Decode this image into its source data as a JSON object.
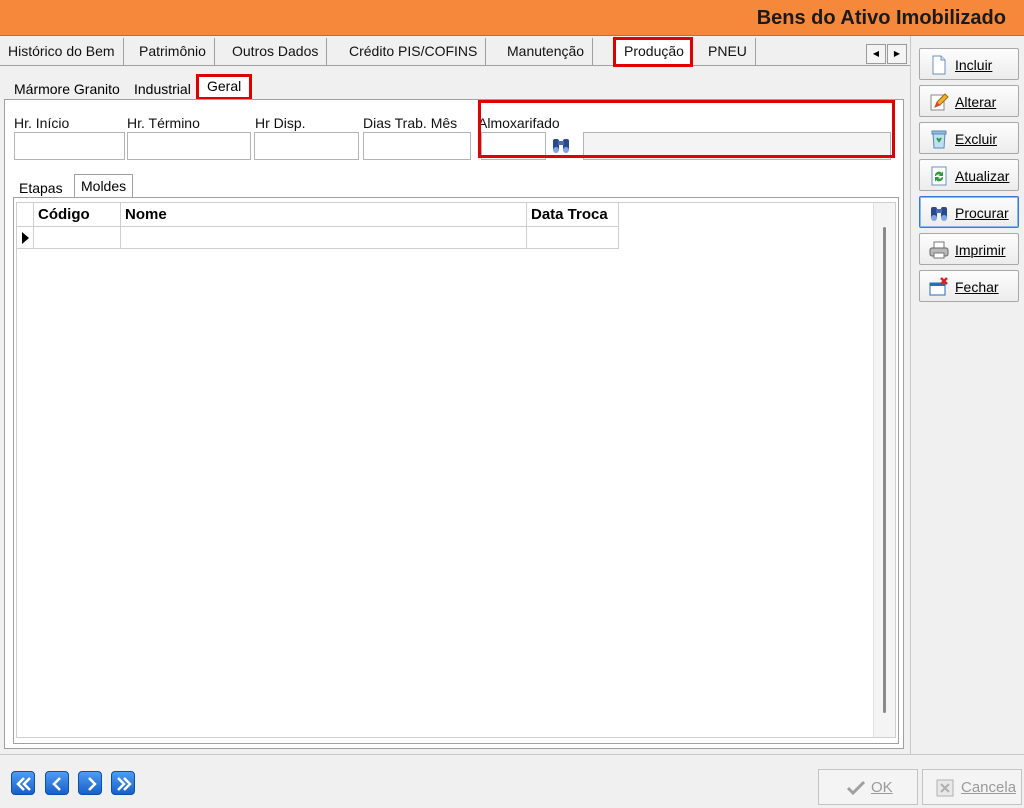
{
  "window": {
    "title": "Bens do Ativo Imobilizado"
  },
  "tabs_main": [
    {
      "label": "Histórico do Bem"
    },
    {
      "label": "Patrimônio"
    },
    {
      "label": "Outros Dados"
    },
    {
      "label": "Crédito PIS/COFINS"
    },
    {
      "label": "Manutenção"
    },
    {
      "label": "Produção",
      "active": true
    },
    {
      "label": "PNEU"
    }
  ],
  "tabs_producao": [
    {
      "label": "Mármore Granito"
    },
    {
      "label": "Industrial"
    },
    {
      "label": "Geral",
      "active": true
    }
  ],
  "fields": {
    "hr_inicio": {
      "label": "Hr. Início",
      "value": ""
    },
    "hr_termino": {
      "label": "Hr. Término",
      "value": ""
    },
    "hr_disp": {
      "label": "Hr Disp.",
      "value": ""
    },
    "dias_trab_mes": {
      "label": "Dias Trab. Mês",
      "value": ""
    },
    "almoxarifado": {
      "label": "Almoxarifado",
      "code": "",
      "description": ""
    }
  },
  "tabs_geral": [
    {
      "label": "Etapas"
    },
    {
      "label": "Moldes",
      "active": true
    }
  ],
  "grid": {
    "columns": [
      "Código",
      "Nome",
      "Data Troca"
    ],
    "rows": [
      [
        "",
        "",
        ""
      ]
    ]
  },
  "actions": [
    {
      "label": "Incluir",
      "icon": "new-document-icon"
    },
    {
      "label": "Alterar",
      "icon": "edit-pencil-icon"
    },
    {
      "label": "Excluir",
      "icon": "recycle-bin-icon"
    },
    {
      "label": "Atualizar",
      "icon": "refresh-icon"
    },
    {
      "label": "Procurar",
      "icon": "binoculars-icon"
    },
    {
      "label": "Imprimir",
      "icon": "printer-icon"
    },
    {
      "label": "Fechar",
      "icon": "close-window-icon"
    }
  ],
  "footer": {
    "ok_label": "OK",
    "cancel_label": "Cancela"
  },
  "colors": {
    "titlebar": "#f5883a",
    "highlight": "#e00000",
    "nav": "#1f6fd6"
  }
}
